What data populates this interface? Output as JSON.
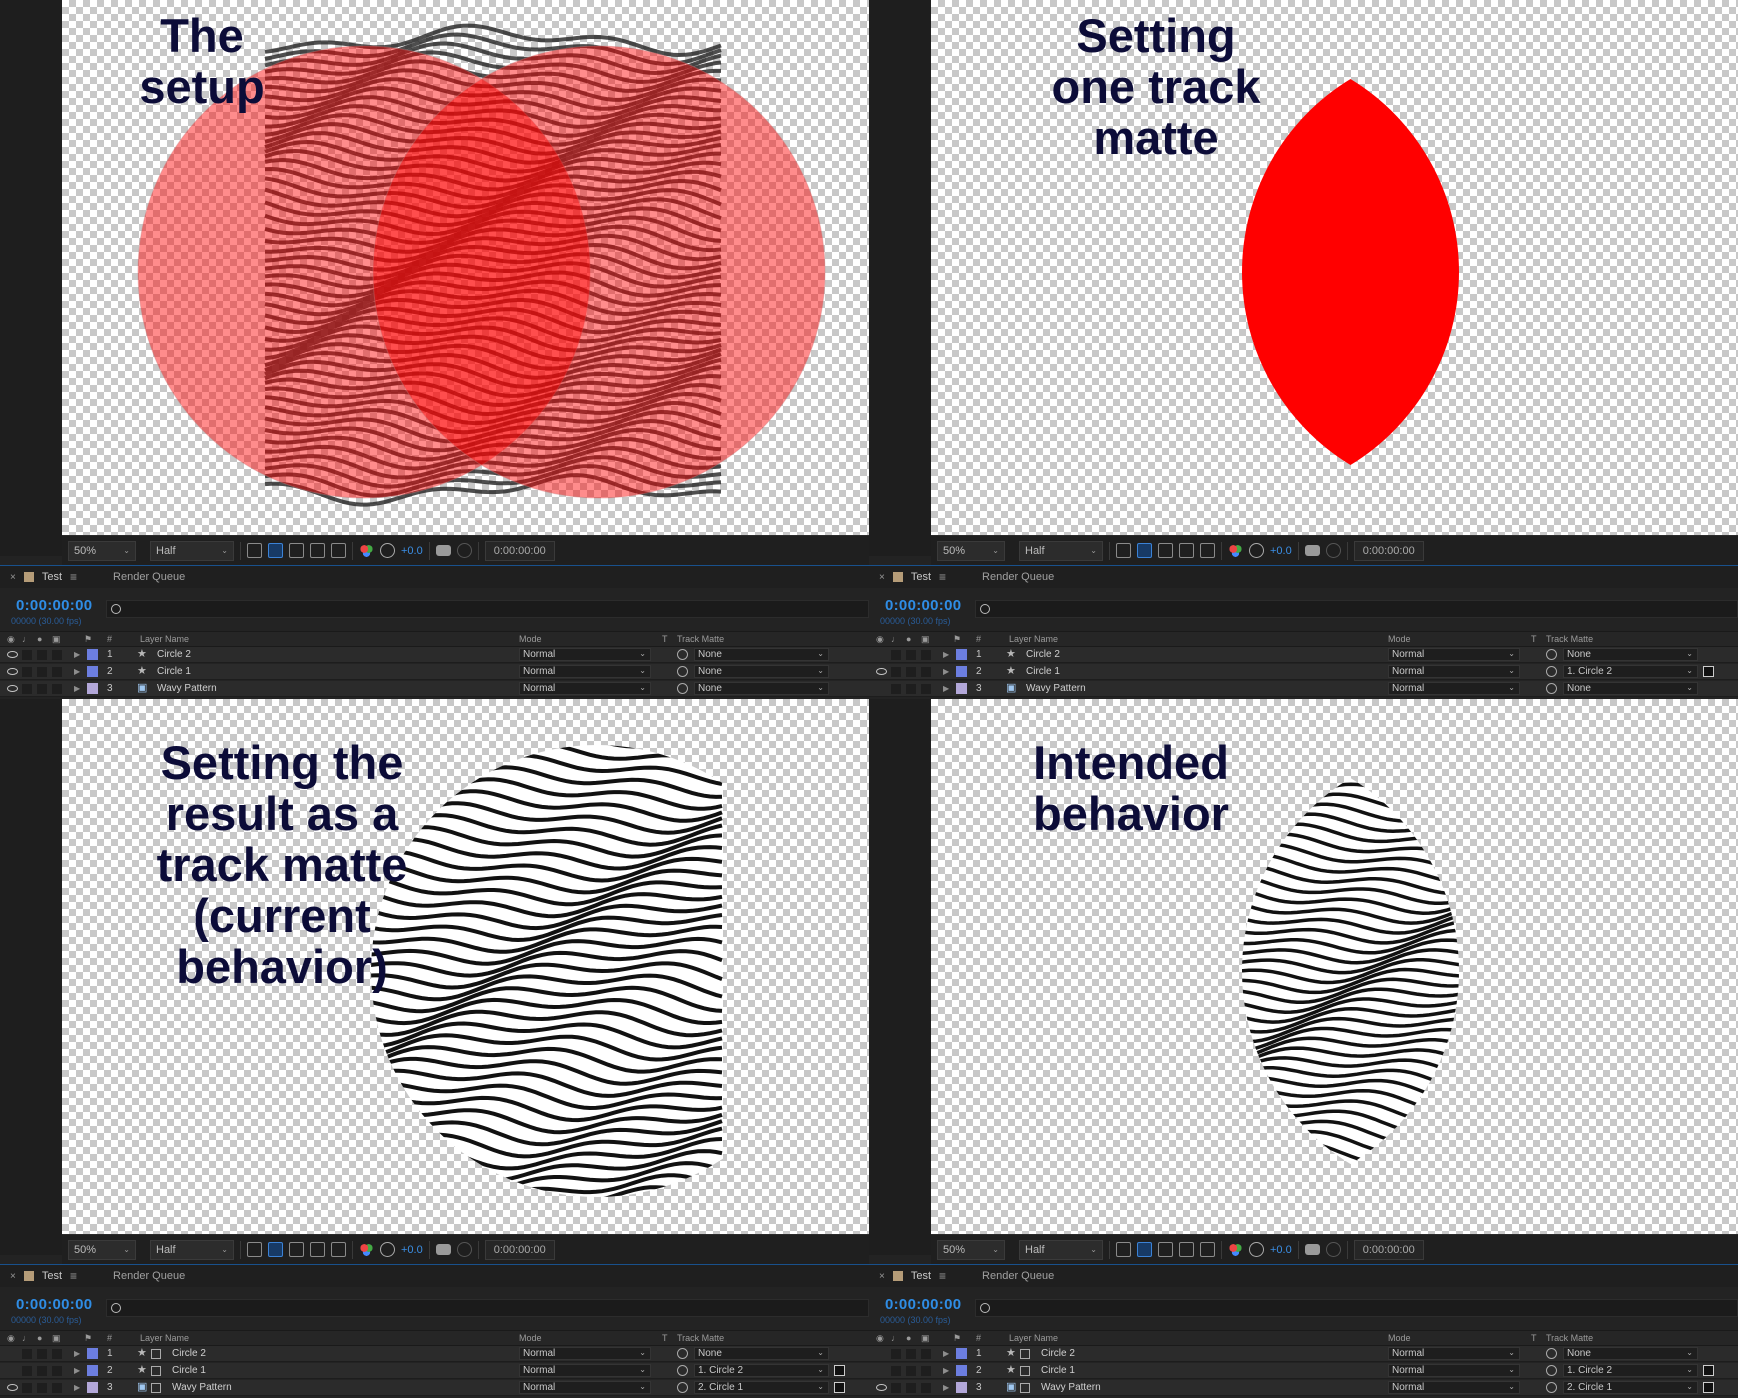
{
  "panels": [
    {
      "title": "The\nsetup",
      "viewer": {
        "zoom": "50%",
        "resolution": "Half",
        "exposure": "+0.0",
        "timecode": "0:00:00:00"
      },
      "timeline": {
        "tab": "Test",
        "render_queue": "Render Queue",
        "current_time": "0:00:00:00",
        "frame_info": "00000 (30.00 fps)",
        "columns": {
          "name": "Layer Name",
          "mode": "Mode",
          "t": "T",
          "track_matte": "Track Matte",
          "num": "#"
        },
        "layers": [
          {
            "num": "1",
            "name": "Circle 2",
            "mode": "Normal",
            "matte": "None",
            "eye": true,
            "color": "#6c7ee0",
            "icon": "star",
            "invert": false
          },
          {
            "num": "2",
            "name": "Circle 1",
            "mode": "Normal",
            "matte": "None",
            "eye": true,
            "color": "#6c7ee0",
            "icon": "star",
            "invert": false
          },
          {
            "num": "3",
            "name": "Wavy Pattern",
            "mode": "Normal",
            "matte": "None",
            "eye": true,
            "color": "#b3a8d9",
            "icon": "file",
            "invert": false
          }
        ]
      }
    },
    {
      "title": "Setting\none track\nmatte",
      "viewer": {
        "zoom": "50%",
        "resolution": "Half",
        "exposure": "+0.0",
        "timecode": "0:00:00:00"
      },
      "timeline": {
        "tab": "Test",
        "render_queue": "Render Queue",
        "current_time": "0:00:00:00",
        "frame_info": "00000 (30.00 fps)",
        "columns": {
          "name": "Layer Name",
          "mode": "Mode",
          "t": "T",
          "track_matte": "Track Matte",
          "num": "#"
        },
        "layers": [
          {
            "num": "1",
            "name": "Circle 2",
            "mode": "Normal",
            "matte": "None",
            "eye": false,
            "color": "#6c7ee0",
            "icon": "star",
            "invert": false
          },
          {
            "num": "2",
            "name": "Circle 1",
            "mode": "Normal",
            "matte": "1. Circle 2",
            "eye": true,
            "color": "#6c7ee0",
            "icon": "star",
            "invert": true
          },
          {
            "num": "3",
            "name": "Wavy Pattern",
            "mode": "Normal",
            "matte": "None",
            "eye": false,
            "color": "#b3a8d9",
            "icon": "file",
            "invert": false
          }
        ]
      }
    },
    {
      "title": "Setting the\nresult as a\ntrack matte\n(current\nbehavior)",
      "viewer": {
        "zoom": "50%",
        "resolution": "Half",
        "exposure": "+0.0",
        "timecode": "0:00:00:00"
      },
      "timeline": {
        "tab": "Test",
        "render_queue": "Render Queue",
        "current_time": "0:00:00:00",
        "frame_info": "00000 (30.00 fps)",
        "columns": {
          "name": "Layer Name",
          "mode": "Mode",
          "t": "T",
          "track_matte": "Track Matte",
          "num": "#"
        },
        "layers": [
          {
            "num": "1",
            "name": "Circle 2",
            "mode": "Normal",
            "matte": "None",
            "eye": false,
            "color": "#6c7ee0",
            "icon": "star",
            "invert": false
          },
          {
            "num": "2",
            "name": "Circle 1",
            "mode": "Normal",
            "matte": "1. Circle 2",
            "eye": false,
            "color": "#6c7ee0",
            "icon": "star",
            "invert": true
          },
          {
            "num": "3",
            "name": "Wavy Pattern",
            "mode": "Normal",
            "matte": "2. Circle 1",
            "eye": true,
            "color": "#b3a8d9",
            "icon": "file",
            "invert": true
          }
        ]
      }
    },
    {
      "title": "Intended\nbehavior",
      "viewer": {
        "zoom": "50%",
        "resolution": "Half",
        "exposure": "+0.0",
        "timecode": "0:00:00:00"
      },
      "timeline": {
        "tab": "Test",
        "render_queue": "Render Queue",
        "current_time": "0:00:00:00",
        "frame_info": "00000 (30.00 fps)",
        "columns": {
          "name": "Layer Name",
          "mode": "Mode",
          "t": "T",
          "track_matte": "Track Matte",
          "num": "#"
        },
        "layers": [
          {
            "num": "1",
            "name": "Circle 2",
            "mode": "Normal",
            "matte": "None",
            "eye": false,
            "color": "#6c7ee0",
            "icon": "star",
            "invert": false
          },
          {
            "num": "2",
            "name": "Circle 1",
            "mode": "Normal",
            "matte": "1. Circle 2",
            "eye": false,
            "color": "#6c7ee0",
            "icon": "star",
            "invert": true
          },
          {
            "num": "3",
            "name": "Wavy Pattern",
            "mode": "Normal",
            "matte": "2. Circle 1",
            "eye": true,
            "color": "#b3a8d9",
            "icon": "file",
            "invert": true
          }
        ]
      }
    }
  ],
  "colors": {
    "accent": "#2f8de5",
    "circle": "#ff0000",
    "checker": "#c8c8c8",
    "title_text": "#0c0c38"
  }
}
